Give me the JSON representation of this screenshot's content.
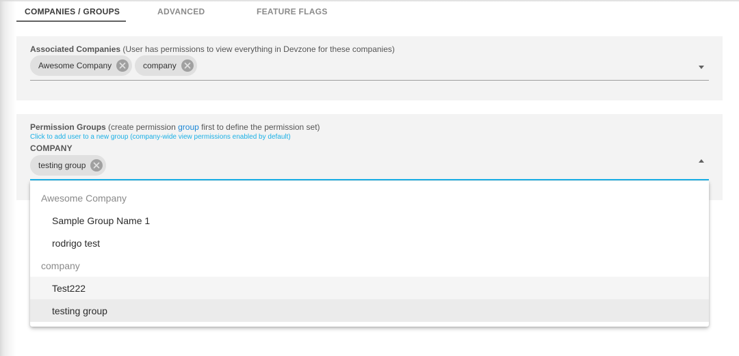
{
  "tabs": [
    {
      "label": "COMPANIES / GROUPS",
      "active": true
    },
    {
      "label": "ADVANCED",
      "active": false
    },
    {
      "label": "FEATURE FLAGS",
      "active": false
    }
  ],
  "companies_field": {
    "label_bold": "Associated Companies",
    "label_rest": "(User has permissions to view everything in Devzone for these companies)",
    "chips": [
      "Awesome Company",
      "company"
    ]
  },
  "groups_field": {
    "label_bold": "Permission Groups",
    "label_pre": "(create permission",
    "label_link": "group",
    "label_post": "first to define the permission set)",
    "hint": "Click to add user to a new group (company-wide view permissions enabled by default)",
    "subheading": "COMPANY",
    "chips": [
      "testing group"
    ]
  },
  "dropdown": {
    "groups": [
      {
        "header": "Awesome Company",
        "options": [
          "Sample Group Name 1",
          "rodrigo test"
        ]
      },
      {
        "header": "company",
        "options": [
          "Test222",
          "testing group"
        ]
      }
    ],
    "hovered_option": "Test222",
    "selected_option": "testing group"
  },
  "colors": {
    "accent": "#1ab0e6",
    "link": "#1c87d6",
    "panel_bg": "#f3f3f3",
    "chip_bg": "#e0e0e0"
  },
  "icons": {
    "chip_remove": "cancel-circle-icon",
    "dropdown_toggle": "caret-icon"
  }
}
